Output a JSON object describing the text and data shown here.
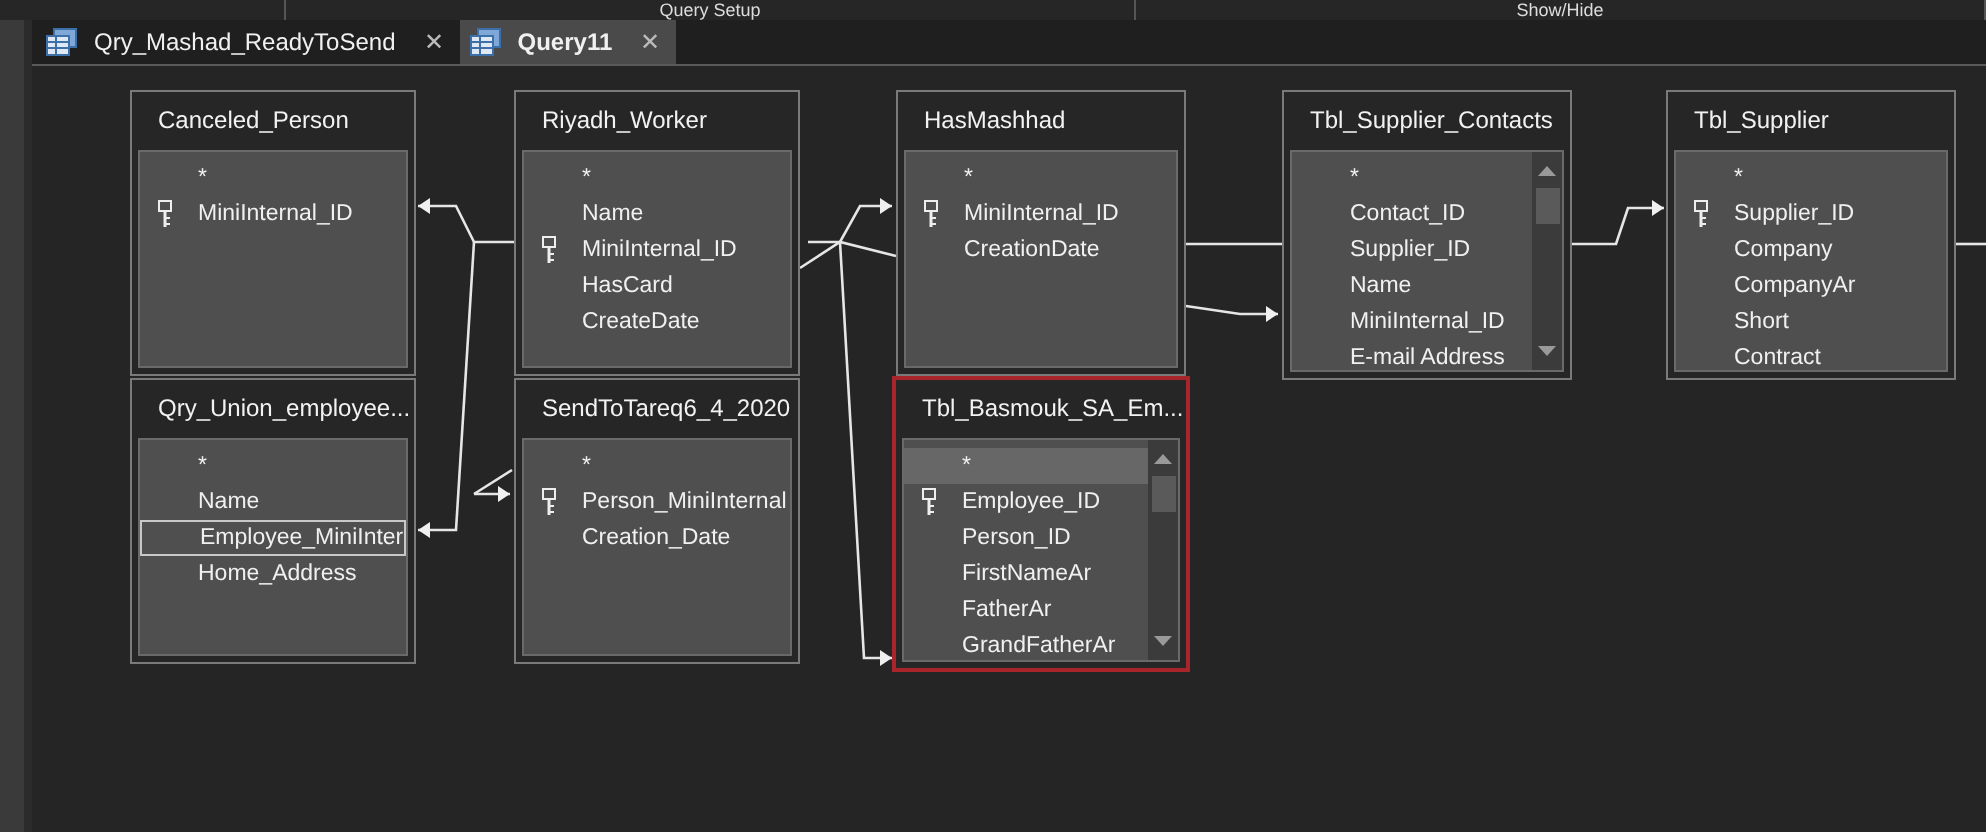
{
  "ribbon": {
    "groups": [
      "Query Setup",
      "Show/Hide"
    ]
  },
  "tabs": [
    {
      "label": "Qry_Mashad_ReadyToSend",
      "selected": false,
      "close": "✕"
    },
    {
      "label": "Query11",
      "selected": true,
      "close": "✕"
    }
  ],
  "tables": [
    {
      "title": "Canceled_Person",
      "selected": false,
      "scrollable": false,
      "fields": [
        {
          "name": "*",
          "key": false,
          "selected": false
        },
        {
          "name": "MiniInternal_ID",
          "key": true,
          "selected": false
        }
      ]
    },
    {
      "title": "Riyadh_Worker",
      "selected": false,
      "scrollable": false,
      "fields": [
        {
          "name": "*",
          "key": false,
          "selected": false
        },
        {
          "name": "Name",
          "key": false,
          "selected": false
        },
        {
          "name": "MiniInternal_ID",
          "key": true,
          "selected": false
        },
        {
          "name": "HasCard",
          "key": false,
          "selected": false
        },
        {
          "name": "CreateDate",
          "key": false,
          "selected": false
        }
      ]
    },
    {
      "title": "HasMashhad",
      "selected": false,
      "scrollable": false,
      "fields": [
        {
          "name": "*",
          "key": false,
          "selected": false
        },
        {
          "name": "MiniInternal_ID",
          "key": true,
          "selected": false
        },
        {
          "name": "CreationDate",
          "key": false,
          "selected": false
        }
      ]
    },
    {
      "title": "Tbl_Supplier_Contacts",
      "selected": false,
      "scrollable": true,
      "fields": [
        {
          "name": "*",
          "key": false,
          "selected": false
        },
        {
          "name": "Contact_ID",
          "key": false,
          "selected": false
        },
        {
          "name": "Supplier_ID",
          "key": false,
          "selected": false
        },
        {
          "name": "Name",
          "key": false,
          "selected": false
        },
        {
          "name": "MiniInternal_ID",
          "key": false,
          "selected": false
        },
        {
          "name": "E-mail Address",
          "key": false,
          "selected": false
        }
      ]
    },
    {
      "title": "Tbl_Supplier",
      "selected": false,
      "scrollable": false,
      "fields": [
        {
          "name": "*",
          "key": false,
          "selected": false
        },
        {
          "name": "Supplier_ID",
          "key": true,
          "selected": false
        },
        {
          "name": "Company",
          "key": false,
          "selected": false
        },
        {
          "name": "CompanyAr",
          "key": false,
          "selected": false
        },
        {
          "name": "Short",
          "key": false,
          "selected": false
        },
        {
          "name": "Contract",
          "key": false,
          "selected": false
        }
      ]
    },
    {
      "title": "Qry_Union_employee...",
      "selected": false,
      "scrollable": false,
      "fields": [
        {
          "name": "*",
          "key": false,
          "selected": false
        },
        {
          "name": "Name",
          "key": false,
          "selected": false
        },
        {
          "name": "Employee_MiniInter",
          "key": false,
          "selected": true
        },
        {
          "name": "Home_Address",
          "key": false,
          "selected": false
        }
      ]
    },
    {
      "title": "SendToTareq6_4_2020",
      "selected": false,
      "scrollable": false,
      "fields": [
        {
          "name": "*",
          "key": false,
          "selected": false
        },
        {
          "name": "Person_MiniInternal",
          "key": true,
          "selected": false
        },
        {
          "name": "Creation_Date",
          "key": false,
          "selected": false
        }
      ]
    },
    {
      "title": "Tbl_Basmouk_SA_Em...",
      "selected": true,
      "scrollable": true,
      "fields": [
        {
          "name": "*",
          "key": false,
          "selected": true
        },
        {
          "name": "Employee_ID",
          "key": true,
          "selected": false
        },
        {
          "name": "Person_ID",
          "key": false,
          "selected": false
        },
        {
          "name": "FirstNameAr",
          "key": false,
          "selected": false
        },
        {
          "name": "FatherAr",
          "key": false,
          "selected": false
        },
        {
          "name": "GrandFatherAr",
          "key": false,
          "selected": false
        }
      ]
    }
  ]
}
